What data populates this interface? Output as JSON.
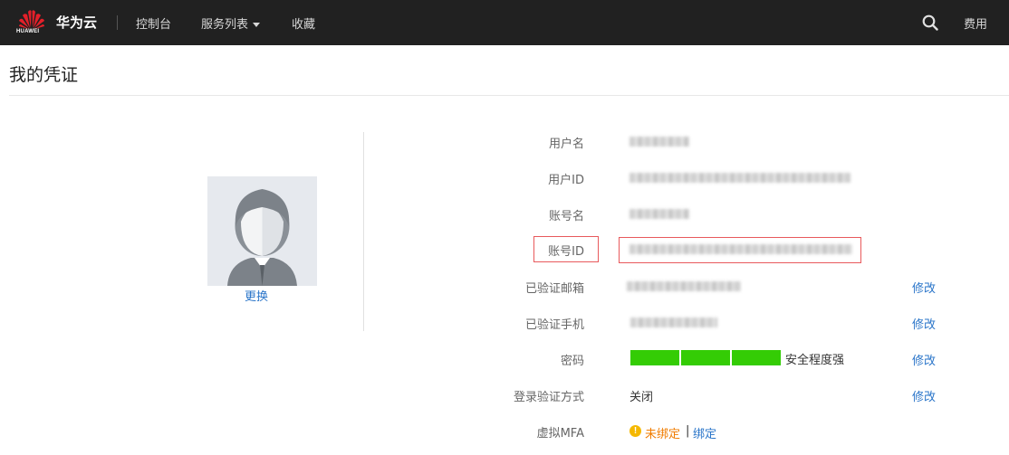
{
  "topbar": {
    "logo_text": "HUAWEI",
    "brand": "华为云",
    "nav": [
      {
        "label": "控制台"
      },
      {
        "label": "服务列表"
      },
      {
        "label": "收藏"
      }
    ],
    "fee_label": "费用",
    "search_icon": "search-icon"
  },
  "page": {
    "title": "我的凭证"
  },
  "avatar": {
    "change_label": "更换"
  },
  "info": {
    "rows": [
      {
        "label": "用户名"
      },
      {
        "label": "用户ID"
      },
      {
        "label": "账号名"
      },
      {
        "label": "账号ID"
      },
      {
        "label": "已验证邮箱",
        "action": "修改"
      },
      {
        "label": "已验证手机",
        "action": "修改"
      },
      {
        "label": "密码",
        "action": "修改"
      },
      {
        "label": "登录验证方式",
        "value": "关闭",
        "action": "修改"
      },
      {
        "label": "虚拟MFA"
      }
    ],
    "password_strength": {
      "text": "安全程度强",
      "filled_segments": 3,
      "total_segments": 3
    },
    "mfa": {
      "status": "未绑定",
      "separator": "|",
      "bind_label": "绑定"
    }
  },
  "colors": {
    "topbar_bg": "#212121",
    "link": "#2a75c9",
    "highlight": "#e8595c",
    "strength": "#34cc05",
    "warning": "#f5b800",
    "unbound": "#f07c00"
  }
}
